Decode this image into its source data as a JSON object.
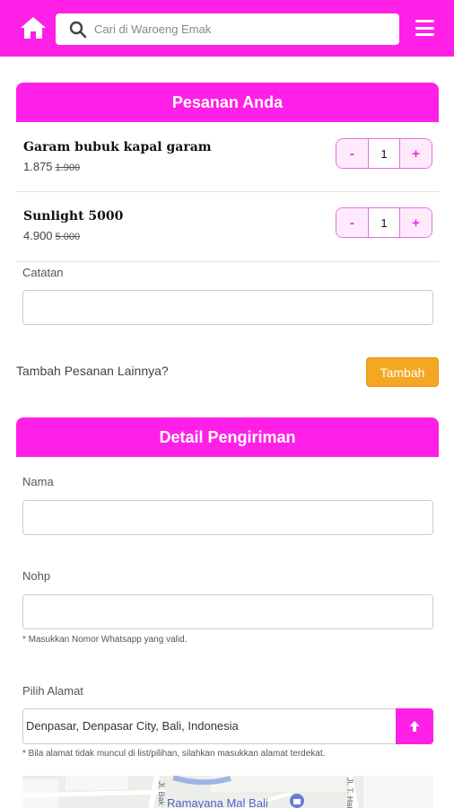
{
  "header": {
    "search_placeholder": "Cari di Waroeng Emak"
  },
  "order": {
    "title": "Pesanan Anda",
    "items": [
      {
        "name": "Garam bubuk kapal garam",
        "price": "1.875",
        "old_price": "1.900",
        "qty": "1"
      },
      {
        "name": "Sunlight 5000",
        "price": "4.900",
        "old_price": "5.000",
        "qty": "1"
      }
    ],
    "minus_label": "-",
    "plus_label": "+",
    "note_label": "Catatan",
    "more_label": "Tambah Pesanan Lainnya?",
    "add_button": "Tambah"
  },
  "shipping": {
    "title": "Detail Pengiriman",
    "name_label": "Nama",
    "phone_label": "Nohp",
    "phone_hint": "* Masukkan Nomor Whatsapp yang valid.",
    "address_label": "Pilih Alamat",
    "address_value": "Denpasar, Denpasar City, Bali, Indonesia",
    "address_hint": "* Bila alamat tidak muncul di list/pilihan, silahkan masukkan alamat terdekat."
  },
  "map": {
    "place_label": "Ramayana Mal Bali",
    "street_a": "Jl. Bak",
    "street_b": "Jl. T. Hary"
  },
  "colors": {
    "brand": "#ff1fe6",
    "accent_button": "#f5a623"
  },
  "icons": [
    "home-icon",
    "search-icon",
    "menu-icon",
    "arrow-up-icon",
    "shopping-bag-icon"
  ]
}
